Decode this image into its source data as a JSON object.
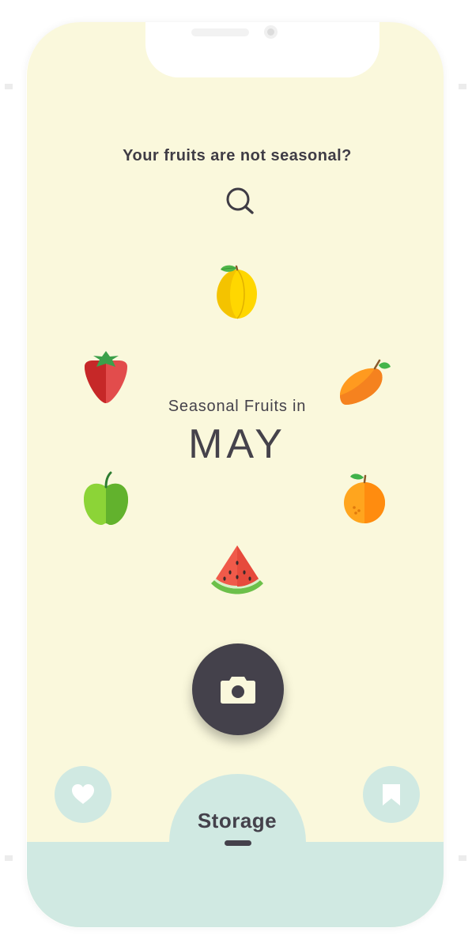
{
  "header": {
    "question": "Your fruits are not seasonal?"
  },
  "search": {
    "icon": "search-icon"
  },
  "season": {
    "subtitle": "Seasonal Fruits in",
    "month": "MAY"
  },
  "fruits": [
    {
      "name": "lemon",
      "icon": "lemon-icon"
    },
    {
      "name": "strawberry",
      "icon": "strawberry-icon"
    },
    {
      "name": "mango",
      "icon": "mango-icon"
    },
    {
      "name": "apple",
      "icon": "apple-icon"
    },
    {
      "name": "orange",
      "icon": "orange-icon"
    },
    {
      "name": "watermelon",
      "icon": "watermelon-icon"
    }
  ],
  "actions": {
    "camera_icon": "camera-icon",
    "favorites_icon": "heart-icon",
    "saved_icon": "bookmark-icon"
  },
  "nav": {
    "storage_label": "Storage"
  },
  "colors": {
    "background": "#faf8dc",
    "accent_mint": "#d0e9e2",
    "dark": "#44414b"
  }
}
